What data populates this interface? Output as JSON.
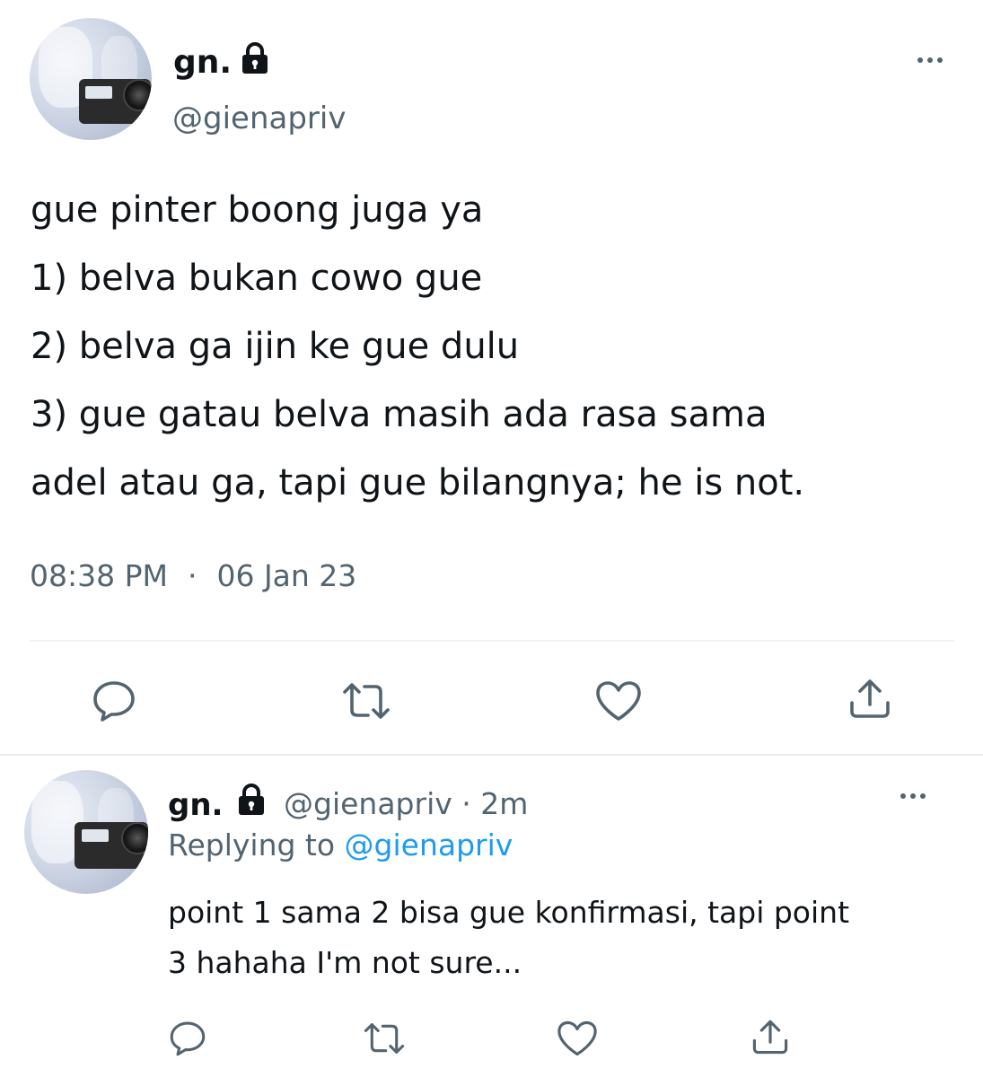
{
  "main_tweet": {
    "display_name": "gn.",
    "handle": "@gienapriv",
    "lines": [
      "gue pinter boong juga ya",
      "1) belva bukan cowo gue",
      "2) belva ga ijin ke gue dulu",
      "3) gue gatau belva masih ada rasa sama",
      "adel atau ga, tapi gue bilangnya; he is not."
    ],
    "time": "08:38 PM",
    "separator": "·",
    "date": "06 Jan 23"
  },
  "reply_tweet": {
    "display_name": "gn.",
    "handle_time": "@gienapriv · 2m",
    "replying_prefix": "Replying to",
    "replying_handle": "@gienapriv",
    "lines": [
      "point 1 sama 2 bisa gue konfirmasi, tapi point",
      "3 hahaha I'm not sure..."
    ]
  },
  "icons": {
    "lock": "lock-icon",
    "more": "more-icon",
    "reply": "reply-icon",
    "retweet": "retweet-icon",
    "like": "like-icon",
    "share": "share-icon"
  },
  "colors": {
    "text": "#0f1419",
    "secondary": "#536471",
    "link": "#1d9bf0",
    "divider": "#eff3f4"
  }
}
